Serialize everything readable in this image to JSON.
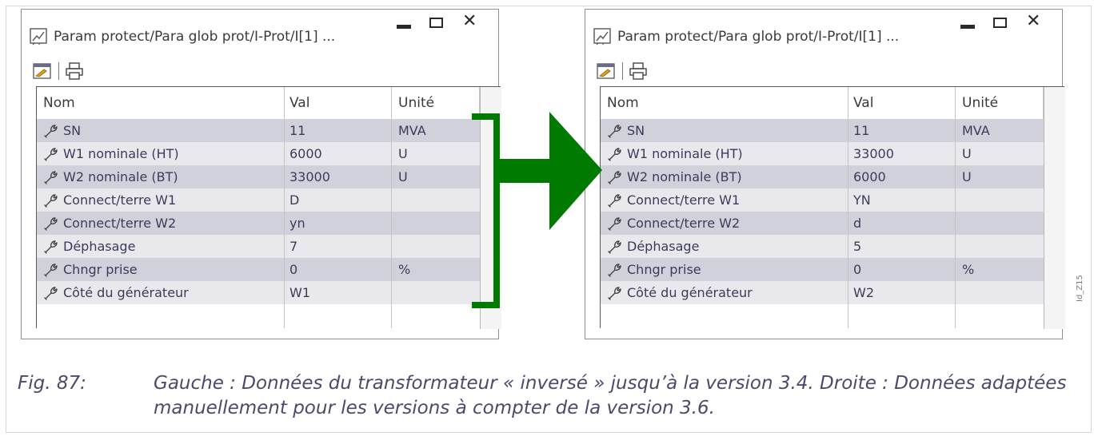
{
  "windows": [
    {
      "title": "Param protect/Para glob prot/I-Prot/I[1]  ...",
      "columns": [
        "Nom",
        "Val",
        "Unité"
      ],
      "rows": [
        {
          "name": "SN",
          "value": "11",
          "unit": "MVA"
        },
        {
          "name": "W1 nominale (HT)",
          "value": "6000",
          "unit": "U"
        },
        {
          "name": "W2 nominale (BT)",
          "value": "33000",
          "unit": "U"
        },
        {
          "name": "Connect/terre W1",
          "value": "D",
          "unit": ""
        },
        {
          "name": "Connect/terre W2",
          "value": "yn",
          "unit": ""
        },
        {
          "name": "Déphasage",
          "value": "7",
          "unit": ""
        },
        {
          "name": "Chngr prise",
          "value": "0",
          "unit": "%"
        },
        {
          "name": "Côté du générateur",
          "value": "W1",
          "unit": ""
        }
      ]
    },
    {
      "title": "Param protect/Para glob prot/I-Prot/I[1]  ...",
      "columns": [
        "Nom",
        "Val",
        "Unité"
      ],
      "rows": [
        {
          "name": "SN",
          "value": "11",
          "unit": "MVA"
        },
        {
          "name": "W1 nominale (HT)",
          "value": "33000",
          "unit": "U"
        },
        {
          "name": "W2 nominale (BT)",
          "value": "6000",
          "unit": "U"
        },
        {
          "name": "Connect/terre W1",
          "value": "YN",
          "unit": ""
        },
        {
          "name": "Connect/terre W2",
          "value": "d",
          "unit": ""
        },
        {
          "name": "Déphasage",
          "value": "5",
          "unit": ""
        },
        {
          "name": "Chngr prise",
          "value": "0",
          "unit": "%"
        },
        {
          "name": "Côté du générateur",
          "value": "W2",
          "unit": ""
        }
      ]
    }
  ],
  "window_controls": {
    "close": "✕"
  },
  "caption": {
    "number": "Fig. 87:",
    "text": "Gauche : Données du transformateur « inversé » jusqu’à la version 3.4. Droite : Données adaptées manuellement pour les versions à compter de la version 3.6."
  },
  "side_id": "Id_Z15",
  "colors": {
    "arrow": "#007a00",
    "row_dark": "#d1d1dc",
    "row_light": "#e9e9ed"
  }
}
